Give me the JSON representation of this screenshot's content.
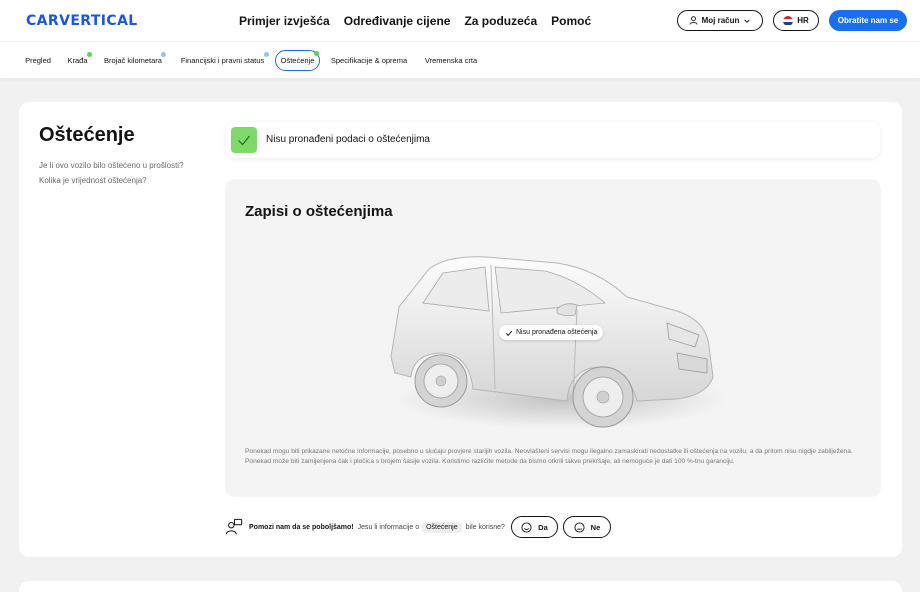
{
  "header": {
    "logo": "CARVERTICAL",
    "nav": [
      "Primjer izvješća",
      "Određivanje cijene",
      "Za poduzeća",
      "Pomoć"
    ],
    "account_label": "Moj račun",
    "lang_label": "HR",
    "contact_label": "Obratite nam se"
  },
  "subnav": {
    "items": [
      {
        "label": "Pregled"
      },
      {
        "label": "Krađa"
      },
      {
        "label": "Brojač kilometara"
      },
      {
        "label": "Financijski i pravni status"
      },
      {
        "label": "Oštećenje"
      },
      {
        "label": "Specifikacije & oprema"
      },
      {
        "label": "Vremenska crta"
      }
    ],
    "active": "Oštećenje",
    "dot_colors": {
      "green": "#5ccf5c",
      "blue": "#8fc6f0"
    }
  },
  "section": {
    "title": "Oštećenje",
    "desc_line1": "Je li ovo vozilo bilo oštećeno u prošlosti?",
    "desc_line2": "Kolika je vrijednost oštećenja?",
    "banner_text": "Nisu pronađeni podaci o oštećenjima",
    "records_title": "Zapisi o oštećenjima",
    "car_tag": "Nisu pronađena oštećenja",
    "disclaimer": "Ponekad mogu biti prikazane netočne informacije, posebno u slučaju provjere starijih vozila. Neovlašteni servisi mogu ilegalno zamaskirati nedostatke ili oštećenja na vozilu, a da pritom nisu nigdje zabilježena. Ponekad može biti zamijenjena čak i pločica s brojem šasije vozila. Koristimo različite metode da bismo otkrili takve prekršaje, ali nemoguće je dati 100 %-tnu garanciju."
  },
  "feedback": {
    "strong": "Pomozi nam da se poboljšamo!",
    "text": "Jesu li informacije o",
    "chip": "Oštećenje",
    "text2": "bile korisne?",
    "yes": "Da",
    "no": "Ne"
  },
  "colors": {
    "brand": "#1a56e0",
    "accent": "#1a6ef0",
    "success": "#7ed96a"
  }
}
